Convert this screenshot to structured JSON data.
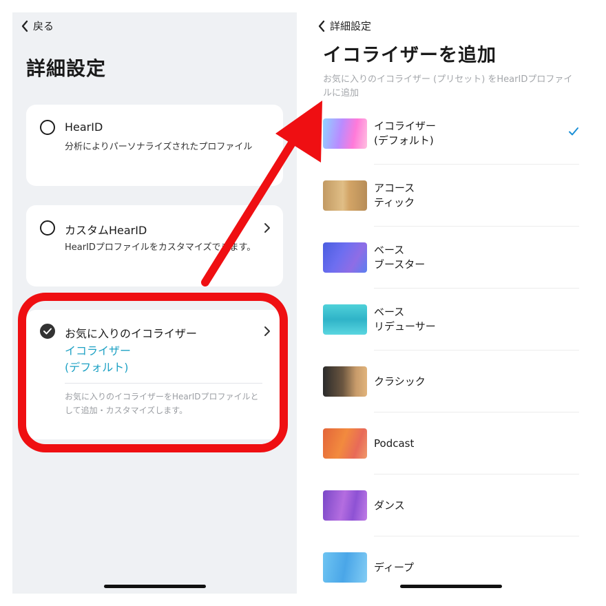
{
  "left_screen": {
    "back_label": "戻る",
    "title": "詳細設定",
    "options": [
      {
        "title": "HearID",
        "description": "分析によりパーソナライズされたプロファイル",
        "selected": false
      },
      {
        "title": "カスタムHearID",
        "description": "HearIDプロファイルをカスタマイズできます。",
        "selected": false
      },
      {
        "title": "お気に入りのイコライザー",
        "value_line1": "イコライザー",
        "value_line2": "(デフォルト)",
        "description": "お気に入りのイコライザーをHearIDプロファイルとして追加・カスタマイズします。",
        "selected": true
      }
    ]
  },
  "right_screen": {
    "back_label": "詳細設定",
    "title": "イコライザーを追加",
    "subtitle": "お気に入りのイコライザー (プリセット) をHearIDプロファイルに追加",
    "presets": [
      {
        "label": "イコライザー\n(デフォルト)",
        "selected": true,
        "thumb": "default-thumbnail"
      },
      {
        "label": "アコース\nティック",
        "selected": false,
        "thumb": "acoustic-thumbnail"
      },
      {
        "label": "ベース\nブースター",
        "selected": false,
        "thumb": "bass-booster-thumbnail"
      },
      {
        "label": "ベース\nリデューサー",
        "selected": false,
        "thumb": "bass-reducer-thumbnail"
      },
      {
        "label": "クラシック",
        "selected": false,
        "thumb": "classic-thumbnail"
      },
      {
        "label": "Podcast",
        "selected": false,
        "thumb": "podcast-thumbnail"
      },
      {
        "label": "ダンス",
        "selected": false,
        "thumb": "dance-thumbnail"
      },
      {
        "label": "ディープ",
        "selected": false,
        "thumb": "deep-thumbnail"
      }
    ]
  },
  "colors": {
    "accent_link": "#1da1c4",
    "highlight_frame": "#ef0f12",
    "annotation_arrow": "#ef0f12",
    "check_mark": "#1a8fd6"
  },
  "icons": [
    "chevron-left-icon",
    "chevron-right-icon",
    "radio-icon",
    "checkmark-icon",
    "annotation-arrow"
  ]
}
